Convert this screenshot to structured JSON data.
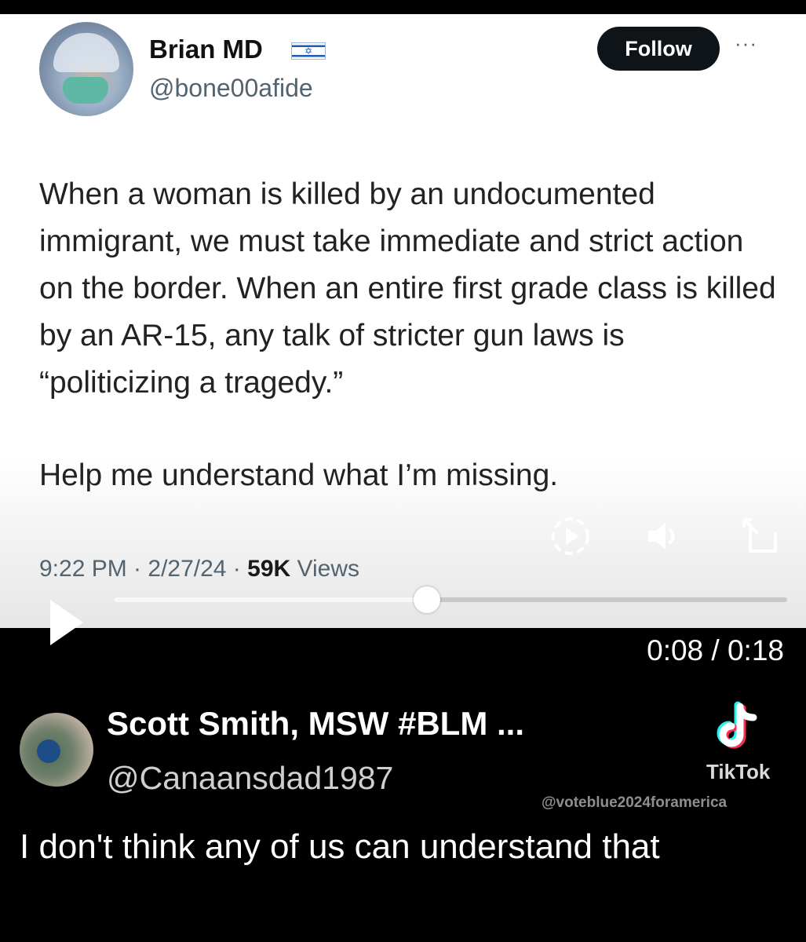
{
  "tweet": {
    "author_name": "Brian MD",
    "flag_symbol": "✡",
    "handle": "@bone00afide",
    "follow_label": "Follow",
    "more_label": "···",
    "paragraphs": [
      "When a woman is killed by an undocumented immigrant, we must take immediate and strict action on the border. When an entire first grade class is killed by an AR-15, any talk of stricter gun laws is “politicizing a tragedy.”",
      "Help me understand what I’m missing."
    ],
    "time_date": "9:22 PM · 2/27/24 · ",
    "views_count": "59K",
    "views_label": " Views"
  },
  "player": {
    "progress_percent": 46.5,
    "current_time": "0:08",
    "separator": " / ",
    "duration": "0:18",
    "icons": [
      "play-icon",
      "replay-icon",
      "volume-icon",
      "fullscreen-icon"
    ]
  },
  "post": {
    "author_name": "Scott Smith, MSW #BLM ...",
    "handle": "@Canaansdad1987",
    "text": "I don't think any of us can understand that"
  },
  "watermark": {
    "brand": "TikTok",
    "username": "@voteblue2024foramerica",
    "colors": {
      "cyan": "#25f4ee",
      "red": "#fe2c55"
    }
  }
}
